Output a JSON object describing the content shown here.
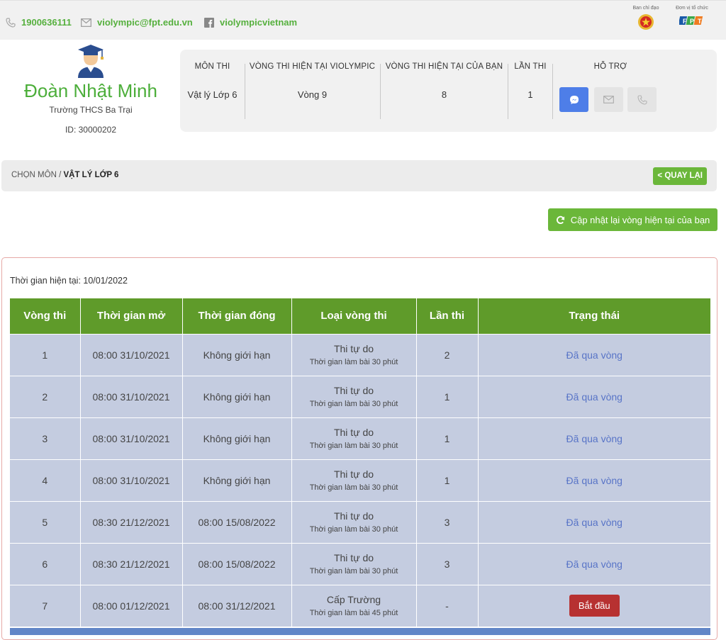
{
  "topbar": {
    "phone": "1900636111",
    "email": "violympic@fpt.edu.vn",
    "facebook": "violympicvietnam",
    "org_director_label": "Ban chỉ đạo",
    "org_organizer_label": "Đơn vị tổ chức"
  },
  "profile": {
    "name": "Đoàn Nhật Minh",
    "school": "Trường THCS Ba Trại",
    "id": "ID: 30000202"
  },
  "info": {
    "subject_header": "MÔN THI",
    "subject_value": "Vật lý Lớp 6",
    "current_round_header": "VÒNG THI HIỆN TẠI VIOLYMPIC",
    "current_round_value": "Vòng 9",
    "your_round_header": "VÒNG THI HIỆN TẠI CỦA BẠN",
    "your_round_value": "8",
    "attempts_header": "LẦN THI",
    "attempts_value": "1",
    "support_header": "HỖ TRỢ"
  },
  "breadcrumb": {
    "root": "CHỌN MÔN",
    "sep": " / ",
    "current": "VẬT LÝ LỚP 6",
    "back_label": "< QUAY LẠI"
  },
  "refresh_label": "Cập nhật lại vòng hiện tại của bạn",
  "current_time": "Thời gian hiện tại: 10/01/2022",
  "table": {
    "headers": [
      "Vòng thi",
      "Thời gian mở",
      "Thời gian đóng",
      "Loại vòng thi",
      "Lần thi",
      "Trạng thái"
    ],
    "rows": [
      {
        "round": "1",
        "open": "08:00 31/10/2021",
        "close": "Không giới hạn",
        "type": "Thi tự do",
        "type_sub": "Thời gian làm bài 30 phút",
        "attempts": "2",
        "status": "Đã qua vòng"
      },
      {
        "round": "2",
        "open": "08:00 31/10/2021",
        "close": "Không giới hạn",
        "type": "Thi tự do",
        "type_sub": "Thời gian làm bài 30 phút",
        "attempts": "1",
        "status": "Đã qua vòng"
      },
      {
        "round": "3",
        "open": "08:00 31/10/2021",
        "close": "Không giới hạn",
        "type": "Thi tự do",
        "type_sub": "Thời gian làm bài 30 phút",
        "attempts": "1",
        "status": "Đã qua vòng"
      },
      {
        "round": "4",
        "open": "08:00 31/10/2021",
        "close": "Không giới hạn",
        "type": "Thi tự do",
        "type_sub": "Thời gian làm bài 30 phút",
        "attempts": "1",
        "status": "Đã qua vòng"
      },
      {
        "round": "5",
        "open": "08:30 21/12/2021",
        "close": "08:00 15/08/2022",
        "type": "Thi tự do",
        "type_sub": "Thời gian làm bài 30 phút",
        "attempts": "3",
        "status": "Đã qua vòng"
      },
      {
        "round": "6",
        "open": "08:30 21/12/2021",
        "close": "08:00 15/08/2022",
        "type": "Thi tự do",
        "type_sub": "Thời gian làm bài 30 phút",
        "attempts": "3",
        "status": "Đã qua vòng"
      },
      {
        "round": "7",
        "open": "08:00 01/12/2021",
        "close": "08:00 31/12/2021",
        "type": "Cấp Trường",
        "type_sub": "Thời gian làm bài 45 phút",
        "attempts": "-",
        "status": "Bắt đầu",
        "status_is_button": true
      }
    ]
  },
  "colors": {
    "brand_green": "#56b03e",
    "header_green": "#5f9b2a",
    "row_bg": "#c4cce0",
    "status_blue": "#5874c7",
    "start_red": "#b73131",
    "messenger_blue": "#4e7ee8"
  }
}
